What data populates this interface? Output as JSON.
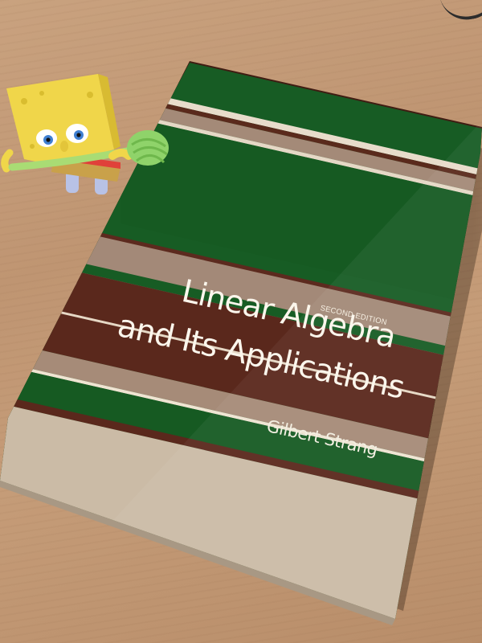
{
  "book": {
    "edition": "SECOND EDITION",
    "title_line1": "Linear Algebra",
    "title_line2": "and Its Applications",
    "author": "Gilbert Strang"
  },
  "colors": {
    "table_wood": "#c49b76",
    "cover_green": "#155a23",
    "cover_brown": "#5c2a1e",
    "cover_tan": "#a48a78",
    "cover_cream": "#cbbba5",
    "toy_yellow": "#f0d64a"
  },
  "objects": {
    "book": "hardcover-textbook",
    "toy": "sponge-figurine-toy",
    "surface": "wooden-table"
  }
}
